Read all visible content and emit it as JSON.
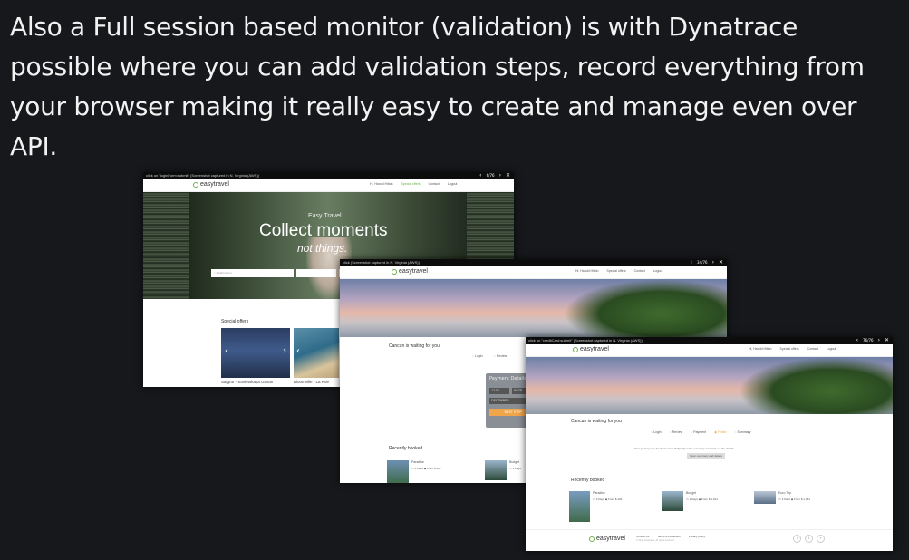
{
  "headline": "Also a Full session based monitor (validation) is with Dynatrace possible where you can add validation steps, record everything from your browser making it really easy to create and manage even over API.",
  "shot1": {
    "bar_text": "click on \"loginForm:submit\" (Screenshot captured in N. Virginia (AWS))",
    "counter": "6/76",
    "logo": "easytravel",
    "menu": [
      "Hi, Harold Hilton",
      "Special offers",
      "Contact",
      "Logout"
    ],
    "hero_kicker": "Easy Travel",
    "hero_title": "Collect moments",
    "hero_sub": "not things.",
    "search_placeholder": "Destination",
    "section_title": "Special offers",
    "offers": [
      "Saigrur - Sovietskaya Gavan'",
      "Bloomville - La Rue"
    ]
  },
  "shot2": {
    "bar_text": "click (Screenshot captured in N. Virginia (AWS))",
    "counter": "34/76",
    "logo": "easytravel",
    "menu": [
      "Hi, Harold Hilton",
      "Special offers",
      "Contact",
      "Logout"
    ],
    "waiting": "Cancun is waiting for you",
    "steps": [
      "Login",
      "Review"
    ],
    "payment_title": "Payment Details",
    "payment_fields": [
      "1234",
      "5678"
    ],
    "payment_name": "DECEMBER",
    "payment_button": "NEXT STEP",
    "recent_title": "Recently booked",
    "recent": [
      {
        "name": "Paradise",
        "days": "3 Days",
        "price": "From $ 294"
      },
      {
        "name": "Budget",
        "days": "2 Days",
        "price": ""
      }
    ]
  },
  "shot3": {
    "bar_text": "click on \"creditCard:submit\" (Screenshot captured in N. Virginia (AWS))",
    "counter": "76/76",
    "logo": "easytravel",
    "menu": [
      "Hi, Harold Hilton",
      "Special offers",
      "Contact",
      "Logout"
    ],
    "waiting": "Cancun is waiting for you",
    "steps": [
      "Login",
      "Review",
      "Payment",
      "Finish",
      "Summary"
    ],
    "done_text": "Your journey was booked successfully! Open the summary and print out the details.",
    "done_button": "Open summary and details",
    "recent_title": "Recently booked",
    "recent": [
      {
        "name": "Paradise",
        "days": "3 Days",
        "price": "From $ 294"
      },
      {
        "name": "Budget",
        "days": "2 Days",
        "price": "From $ 1,014"
      },
      {
        "name": "Euro Trip",
        "days": "4 Days",
        "price": "From $ 1,384"
      }
    ],
    "footer_logo": "easytravel",
    "footer_links": [
      "Contact us",
      "Terms & conditions",
      "Privacy policy"
    ],
    "footer_copy": "© 2018 easytravel. All rights reserved."
  }
}
